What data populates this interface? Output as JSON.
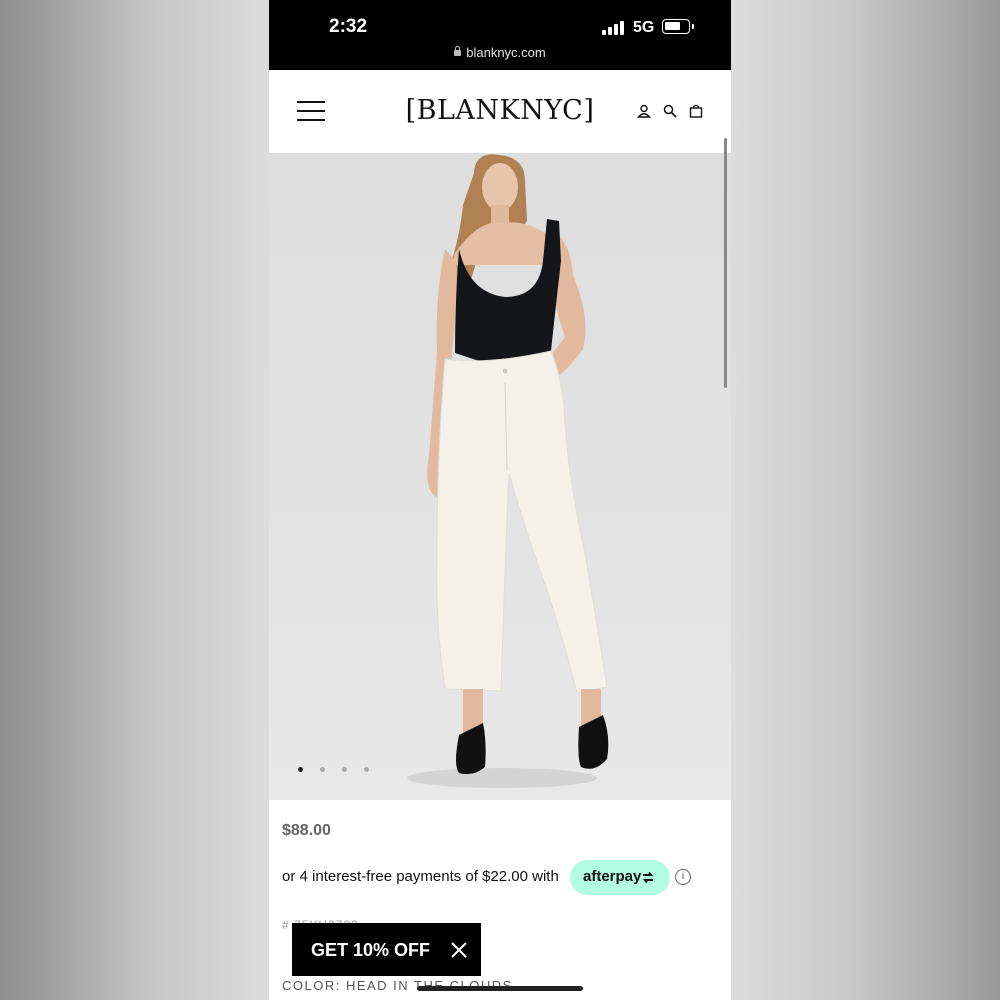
{
  "status_bar": {
    "time": "2:32",
    "network": "5G",
    "signal_bars": 4,
    "battery_level": 0.7
  },
  "browser": {
    "url": "blanknyc.com"
  },
  "header": {
    "logo": "[BLANKNYC]",
    "icons": [
      "menu-icon",
      "account-icon",
      "search-icon",
      "bag-icon"
    ]
  },
  "product": {
    "image_alt": "Model wearing black tank bodysuit and white cropped straight-leg jeans",
    "carousel_dot_count": 4,
    "carousel_active_index": 0,
    "price": "$88.00",
    "installments_text": "or 4 interest-free payments of $22.00 with",
    "afterpay_label": "afterpay",
    "info_symbol": "i",
    "sku": "# 75YH2723",
    "color_text": "COLOR:  HEAD IN THE CLOUDS"
  },
  "popup": {
    "label": "GET 10% OFF"
  },
  "colors": {
    "afterpay_mint": "#b2fce4",
    "status_bar_bg": "#000000",
    "popup_bg": "#000000"
  }
}
